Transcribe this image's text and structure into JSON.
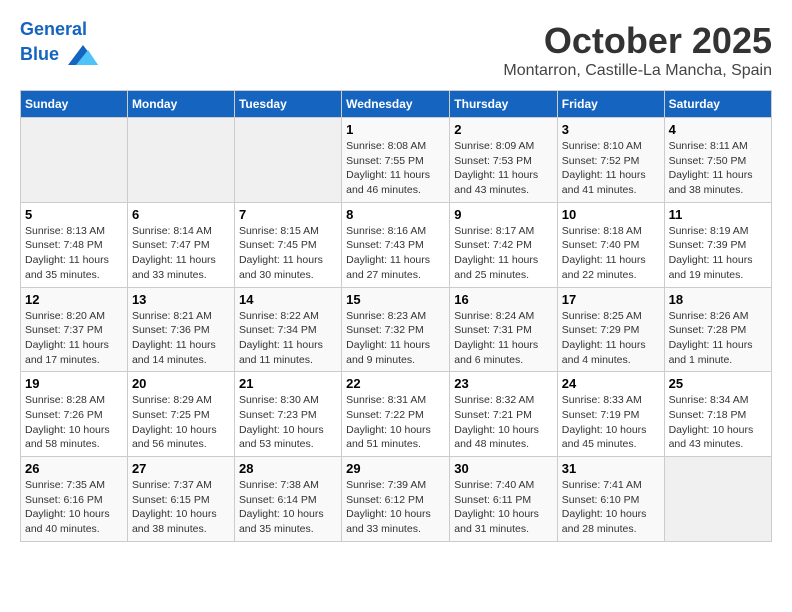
{
  "header": {
    "logo_line1": "General",
    "logo_line2": "Blue",
    "month": "October 2025",
    "location": "Montarron, Castille-La Mancha, Spain"
  },
  "days_of_week": [
    "Sunday",
    "Monday",
    "Tuesday",
    "Wednesday",
    "Thursday",
    "Friday",
    "Saturday"
  ],
  "weeks": [
    [
      {
        "day": "",
        "info": ""
      },
      {
        "day": "",
        "info": ""
      },
      {
        "day": "",
        "info": ""
      },
      {
        "day": "1",
        "info": "Sunrise: 8:08 AM\nSunset: 7:55 PM\nDaylight: 11 hours\nand 46 minutes."
      },
      {
        "day": "2",
        "info": "Sunrise: 8:09 AM\nSunset: 7:53 PM\nDaylight: 11 hours\nand 43 minutes."
      },
      {
        "day": "3",
        "info": "Sunrise: 8:10 AM\nSunset: 7:52 PM\nDaylight: 11 hours\nand 41 minutes."
      },
      {
        "day": "4",
        "info": "Sunrise: 8:11 AM\nSunset: 7:50 PM\nDaylight: 11 hours\nand 38 minutes."
      }
    ],
    [
      {
        "day": "5",
        "info": "Sunrise: 8:13 AM\nSunset: 7:48 PM\nDaylight: 11 hours\nand 35 minutes."
      },
      {
        "day": "6",
        "info": "Sunrise: 8:14 AM\nSunset: 7:47 PM\nDaylight: 11 hours\nand 33 minutes."
      },
      {
        "day": "7",
        "info": "Sunrise: 8:15 AM\nSunset: 7:45 PM\nDaylight: 11 hours\nand 30 minutes."
      },
      {
        "day": "8",
        "info": "Sunrise: 8:16 AM\nSunset: 7:43 PM\nDaylight: 11 hours\nand 27 minutes."
      },
      {
        "day": "9",
        "info": "Sunrise: 8:17 AM\nSunset: 7:42 PM\nDaylight: 11 hours\nand 25 minutes."
      },
      {
        "day": "10",
        "info": "Sunrise: 8:18 AM\nSunset: 7:40 PM\nDaylight: 11 hours\nand 22 minutes."
      },
      {
        "day": "11",
        "info": "Sunrise: 8:19 AM\nSunset: 7:39 PM\nDaylight: 11 hours\nand 19 minutes."
      }
    ],
    [
      {
        "day": "12",
        "info": "Sunrise: 8:20 AM\nSunset: 7:37 PM\nDaylight: 11 hours\nand 17 minutes."
      },
      {
        "day": "13",
        "info": "Sunrise: 8:21 AM\nSunset: 7:36 PM\nDaylight: 11 hours\nand 14 minutes."
      },
      {
        "day": "14",
        "info": "Sunrise: 8:22 AM\nSunset: 7:34 PM\nDaylight: 11 hours\nand 11 minutes."
      },
      {
        "day": "15",
        "info": "Sunrise: 8:23 AM\nSunset: 7:32 PM\nDaylight: 11 hours\nand 9 minutes."
      },
      {
        "day": "16",
        "info": "Sunrise: 8:24 AM\nSunset: 7:31 PM\nDaylight: 11 hours\nand 6 minutes."
      },
      {
        "day": "17",
        "info": "Sunrise: 8:25 AM\nSunset: 7:29 PM\nDaylight: 11 hours\nand 4 minutes."
      },
      {
        "day": "18",
        "info": "Sunrise: 8:26 AM\nSunset: 7:28 PM\nDaylight: 11 hours\nand 1 minute."
      }
    ],
    [
      {
        "day": "19",
        "info": "Sunrise: 8:28 AM\nSunset: 7:26 PM\nDaylight: 10 hours\nand 58 minutes."
      },
      {
        "day": "20",
        "info": "Sunrise: 8:29 AM\nSunset: 7:25 PM\nDaylight: 10 hours\nand 56 minutes."
      },
      {
        "day": "21",
        "info": "Sunrise: 8:30 AM\nSunset: 7:23 PM\nDaylight: 10 hours\nand 53 minutes."
      },
      {
        "day": "22",
        "info": "Sunrise: 8:31 AM\nSunset: 7:22 PM\nDaylight: 10 hours\nand 51 minutes."
      },
      {
        "day": "23",
        "info": "Sunrise: 8:32 AM\nSunset: 7:21 PM\nDaylight: 10 hours\nand 48 minutes."
      },
      {
        "day": "24",
        "info": "Sunrise: 8:33 AM\nSunset: 7:19 PM\nDaylight: 10 hours\nand 45 minutes."
      },
      {
        "day": "25",
        "info": "Sunrise: 8:34 AM\nSunset: 7:18 PM\nDaylight: 10 hours\nand 43 minutes."
      }
    ],
    [
      {
        "day": "26",
        "info": "Sunrise: 7:35 AM\nSunset: 6:16 PM\nDaylight: 10 hours\nand 40 minutes."
      },
      {
        "day": "27",
        "info": "Sunrise: 7:37 AM\nSunset: 6:15 PM\nDaylight: 10 hours\nand 38 minutes."
      },
      {
        "day": "28",
        "info": "Sunrise: 7:38 AM\nSunset: 6:14 PM\nDaylight: 10 hours\nand 35 minutes."
      },
      {
        "day": "29",
        "info": "Sunrise: 7:39 AM\nSunset: 6:12 PM\nDaylight: 10 hours\nand 33 minutes."
      },
      {
        "day": "30",
        "info": "Sunrise: 7:40 AM\nSunset: 6:11 PM\nDaylight: 10 hours\nand 31 minutes."
      },
      {
        "day": "31",
        "info": "Sunrise: 7:41 AM\nSunset: 6:10 PM\nDaylight: 10 hours\nand 28 minutes."
      },
      {
        "day": "",
        "info": ""
      }
    ]
  ]
}
